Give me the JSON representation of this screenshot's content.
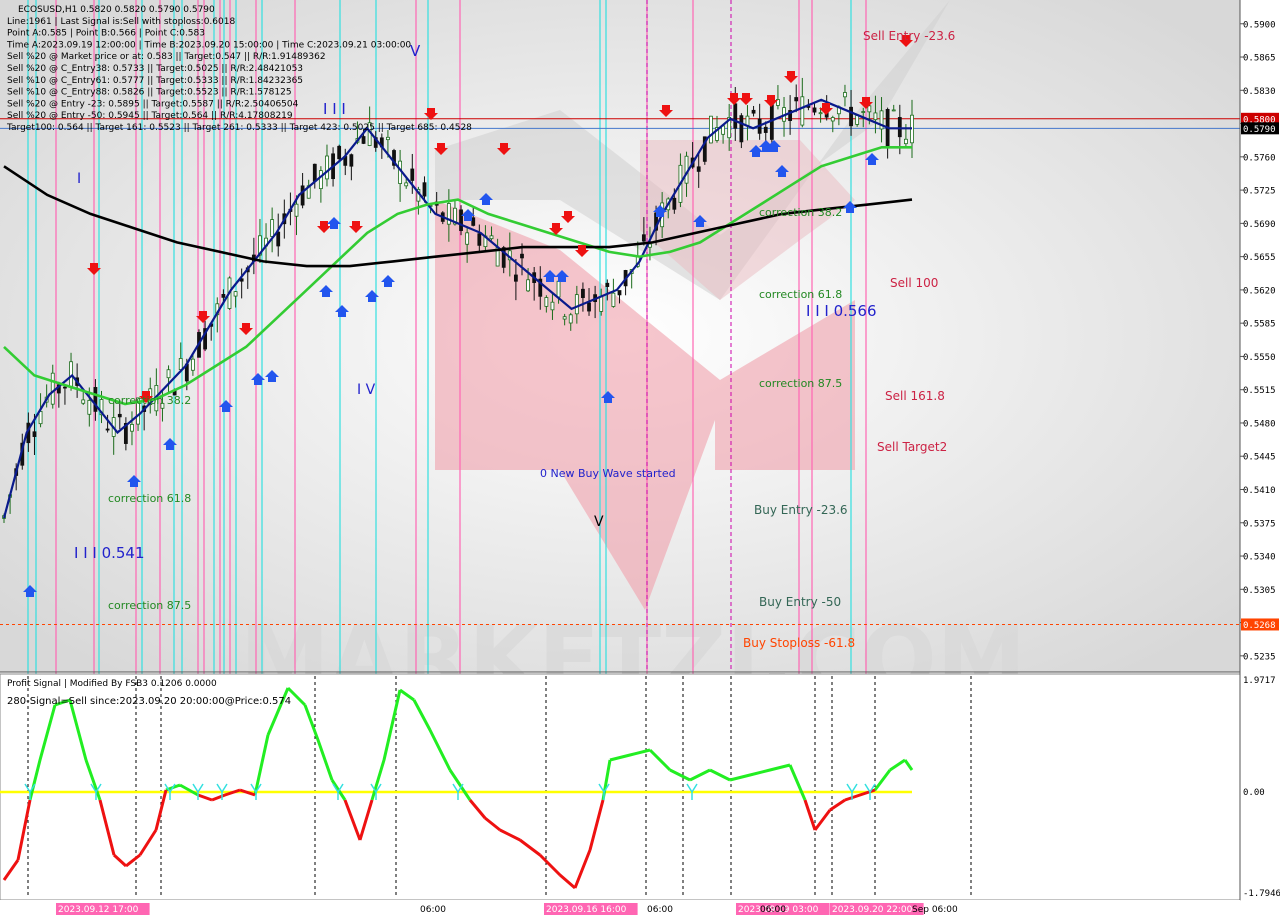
{
  "header": {
    "lines": [
      "ECOSUSD,H1  0.5820 0.5820 0.5790 0.5790",
      "Line:1961 | Last Signal is:Sell with stoploss:0.6018",
      "Point A:0.585 | Point B:0.566 | Point C:0.583",
      "Time A:2023.09.19 12:00:00 | Time B:2023.09.20 15:00:00 | Time C:2023.09.21 03:00:00",
      "Sell %20 @ Market price or at: 0.583 || Target:0.547 || R/R:1.91489362",
      "Sell %20 @ C_Entry38: 0.5733 || Target:0.5025 || R/R:2.48421053",
      "Sell %10 @ C_Entry61: 0.5777 || Target:0.5333 || R/R:1.84232365",
      "Sell %10 @ C_Entry88: 0.5826 || Target:0.5523 || R/R:1.578125",
      "Sell %20 @ Entry -23: 0.5895 || Target:0.5587 || R/R:2.50406504",
      "Sell %20 @ Entry -50: 0.5945 || Target:0.564 || R/R:4.17808219",
      "Target100: 0.564 || Target 161: 0.5523 || Target 261: 0.5333 || Target 423: 0.5025 || Target 685: 0.4528"
    ]
  },
  "price_axis": {
    "ticks": [
      "0.5900",
      "0.5865",
      "0.5830",
      "0.5795",
      "0.5760",
      "0.5725",
      "0.5690",
      "0.5655",
      "0.5620",
      "0.5585",
      "0.5550",
      "0.5515",
      "0.5480",
      "0.5445",
      "0.5410",
      "0.5375",
      "0.5340",
      "0.5305",
      "0.5270",
      "0.5235"
    ],
    "tags": [
      {
        "text": "0.5800",
        "price": 0.58,
        "color": "#cc0000"
      },
      {
        "text": "0.5790",
        "price": 0.579,
        "color": "#000000"
      },
      {
        "text": "0.5268",
        "price": 0.5268,
        "color": "#ff4400"
      }
    ]
  },
  "labels": [
    {
      "text": "Sell Entry -23.6",
      "color": "#cc2244"
    },
    {
      "text": "Sell 100",
      "color": "#cc2244"
    },
    {
      "text": "Sell 161.8",
      "color": "#cc2244"
    },
    {
      "text": "Sell Target2",
      "color": "#cc2244"
    },
    {
      "text": "correction 38.2",
      "color": "#228822"
    },
    {
      "text": "correction 61.8",
      "color": "#228822"
    },
    {
      "text": "correction 87.5",
      "color": "#228822"
    },
    {
      "text": "I I I 0.566",
      "color": "#2222cc"
    },
    {
      "text": "0 New Buy Wave started",
      "color": "#2222cc"
    },
    {
      "text": "Buy Entry -23.6",
      "color": "#336655"
    },
    {
      "text": "Buy Entry -50",
      "color": "#336655"
    },
    {
      "text": "Buy Stoploss -61.8",
      "color": "#ff4400"
    },
    {
      "text": "correction 38.2",
      "color": "#228822"
    },
    {
      "text": "correction 61.8",
      "color": "#228822"
    },
    {
      "text": "correction 87.5",
      "color": "#228822"
    },
    {
      "text": "I I I 0.541",
      "color": "#2222cc"
    },
    {
      "text": "I V",
      "color": "#2222cc"
    },
    {
      "text": "V",
      "color": "#2222cc"
    },
    {
      "text": "I I I",
      "color": "#2222cc"
    },
    {
      "text": "I",
      "color": "#2222cc"
    },
    {
      "text": "V",
      "color": "#000000"
    }
  ],
  "indicator": {
    "line1": "Profit Signal | Modified By FSB3 0.1206 0.0000",
    "line2": "280-Signal=Sell since:2023.09.20 20:00:00@Price:0.574",
    "ticks": [
      "1.9717",
      "0.00",
      "-1.7946"
    ]
  },
  "time_axis": {
    "labels": [
      "2023.09.12 17:00",
      "06:00",
      "2023.09.16 16:00",
      "06:00",
      "2023.09.19 03:00",
      "06:00",
      "2023.09.20 22:00",
      "Sep 06:00"
    ]
  },
  "colors": {
    "bull_candle": "#1a6b1a",
    "bear_candle": "#111111",
    "ma_blue": "#0a1a8c",
    "ma_green": "#33cc33",
    "ma_black": "#000000",
    "vline_cyan": "#33e0e0",
    "vline_pink": "#ff66b3",
    "indicator_green": "#22ee22",
    "indicator_red": "#ee1111",
    "zero_line": "#ffff00",
    "watermark": "#f0a0ab"
  },
  "chart_data": {
    "type": "line",
    "title": "ECOSUSD,H1",
    "ylim": [
      0.5218,
      0.5925
    ],
    "series": [
      {
        "name": "",
        "values": [
          0.538,
          0.547,
          0.551,
          0.553,
          0.55,
          0.547,
          0.549,
          0.5515,
          0.554,
          0.558,
          0.562,
          0.565,
          0.568,
          0.572,
          0.574,
          0.576,
          0.579,
          0.576,
          0.573,
          0.57,
          0.569,
          0.568,
          0.566,
          0.564,
          0.562,
          0.56,
          0.561,
          0.562,
          0.565,
          0.57,
          0.574,
          0.578,
          0.58,
          0.579,
          0.58,
          0.581,
          0.582,
          0.581,
          0.58,
          0.579,
          0.579
        ]
      },
      {
        "name": "",
        "values": [
          0.556,
          0.553,
          0.552,
          0.551,
          0.55,
          0.5505,
          0.552,
          0.554,
          0.556,
          0.559,
          0.562,
          0.565,
          0.568,
          0.57,
          0.571,
          0.5715,
          0.57,
          0.569,
          0.568,
          0.567,
          0.566,
          0.5655,
          0.566,
          0.567,
          0.569,
          0.571,
          0.573,
          0.575,
          0.576,
          0.577,
          0.577
        ]
      },
      {
        "name": "",
        "values": [
          0.575,
          0.572,
          0.57,
          0.5685,
          0.567,
          0.566,
          0.565,
          0.5645,
          0.5645,
          0.565,
          0.5655,
          0.566,
          0.5665,
          0.5665,
          0.5665,
          0.567,
          0.568,
          0.569,
          0.57,
          0.5705,
          0.571,
          0.5715
        ]
      }
    ]
  }
}
